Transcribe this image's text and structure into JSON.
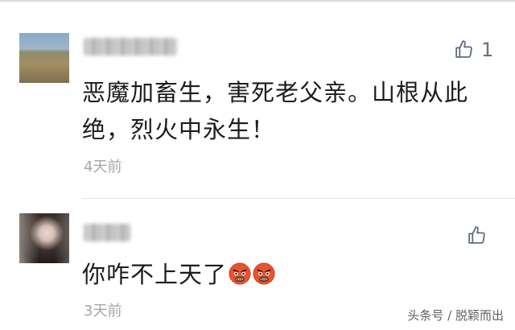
{
  "comments": [
    {
      "likes": "1",
      "text": "恶魔加畜生，害死老父亲。山根从此绝，烈火中永生！",
      "time": "4天前",
      "icons": [
        "avatar",
        "thumbs-up-icon"
      ]
    },
    {
      "likes": "",
      "text": "你咋不上天了",
      "emojis": [
        "angry-face-icon",
        "angry-face-icon"
      ],
      "time": "3天前",
      "icons": [
        "avatar",
        "thumbs-up-icon"
      ]
    }
  ],
  "watermark": "头条号 / 脱颖而出",
  "colors": {
    "text": "#1c1c1c",
    "meta": "#a6a6a6",
    "icon": "#5b6b80",
    "emoji_face": "#e8542e",
    "emoji_dark": "#3a1e12"
  }
}
